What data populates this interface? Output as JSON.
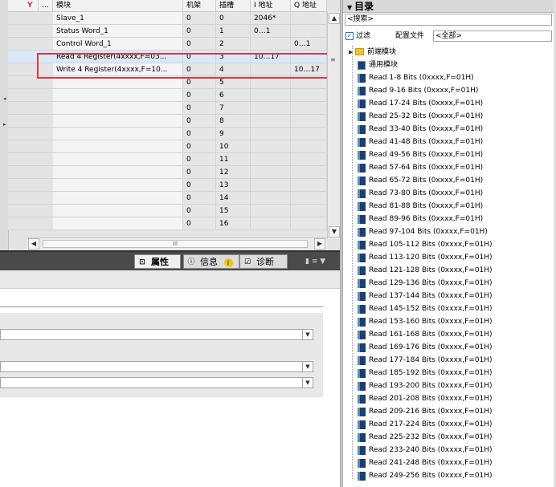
{
  "table": {
    "header": {
      "ellipsis": "...",
      "module": "模块",
      "rack": "机架",
      "slot": "插槽",
      "i_address": "I 地址",
      "q_address": "Q 地址"
    },
    "rows": [
      {
        "module": "Slave_1",
        "rack": "0",
        "slot": "0",
        "i_address": "2046*",
        "q_address": ""
      },
      {
        "module": "Status Word_1",
        "rack": "0",
        "slot": "1",
        "i_address": "0…1",
        "q_address": ""
      },
      {
        "module": "Control Word_1",
        "rack": "0",
        "slot": "2",
        "i_address": "",
        "q_address": "0…1"
      },
      {
        "module": "Read 4 Register(4xxxx,F=03...",
        "rack": "0",
        "slot": "3",
        "i_address": "10…17",
        "q_address": ""
      },
      {
        "module": "Write 4 Register(4xxxx,F=10...",
        "rack": "0",
        "slot": "4",
        "i_address": "",
        "q_address": "10…17"
      },
      {
        "module": "",
        "rack": "0",
        "slot": "5",
        "i_address": "",
        "q_address": ""
      },
      {
        "module": "",
        "rack": "0",
        "slot": "6",
        "i_address": "",
        "q_address": ""
      },
      {
        "module": "",
        "rack": "0",
        "slot": "7",
        "i_address": "",
        "q_address": ""
      },
      {
        "module": "",
        "rack": "0",
        "slot": "8",
        "i_address": "",
        "q_address": ""
      },
      {
        "module": "",
        "rack": "0",
        "slot": "9",
        "i_address": "",
        "q_address": ""
      },
      {
        "module": "",
        "rack": "0",
        "slot": "10",
        "i_address": "",
        "q_address": ""
      },
      {
        "module": "",
        "rack": "0",
        "slot": "11",
        "i_address": "",
        "q_address": ""
      },
      {
        "module": "",
        "rack": "0",
        "slot": "12",
        "i_address": "",
        "q_address": ""
      },
      {
        "module": "",
        "rack": "0",
        "slot": "13",
        "i_address": "",
        "q_address": ""
      },
      {
        "module": "",
        "rack": "0",
        "slot": "14",
        "i_address": "",
        "q_address": ""
      },
      {
        "module": "",
        "rack": "0",
        "slot": "15",
        "i_address": "",
        "q_address": ""
      },
      {
        "module": "",
        "rack": "0",
        "slot": "16",
        "i_address": "",
        "q_address": ""
      }
    ],
    "selected_row": 3,
    "hscroll_thumb": "III"
  },
  "inspector": {
    "tabs": [
      {
        "label": "属性",
        "icon": "properties-icon"
      },
      {
        "label": "信息",
        "icon": "info-icon",
        "badge": "i"
      },
      {
        "label": "诊断",
        "icon": "diagnostics-icon"
      }
    ]
  },
  "catalog": {
    "title": "目录",
    "search_placeholder": "<搜索>",
    "filter_label": "过滤",
    "filter_checked": true,
    "profile_label": "配置文件",
    "profile_value": "<全部>",
    "folders": [
      {
        "label": "前端模块",
        "expanded": false
      },
      {
        "label": "通用模块"
      }
    ],
    "modules": [
      "Read 1-8 Bits (0xxxx,F=01H)",
      "Read 9-16 Bits (0xxxx,F=01H)",
      "Read 17-24 Bits (0xxxx,F=01H)",
      "Read 25-32 Bits (0xxxx,F=01H)",
      "Read 33-40 Bits (0xxxx,F=01H)",
      "Read 41-48 Bits (0xxxx,F=01H)",
      "Read 49-56 Bits (0xxxx,F=01H)",
      "Read 57-64 Bits (0xxxx,F=01H)",
      "Read 65-72 Bits (0xxxx,F=01H)",
      "Read 73-80 Bits (0xxxx,F=01H)",
      "Read 81-88 Bits (0xxxx,F=01H)",
      "Read 89-96 Bits (0xxxx,F=01H)",
      "Read 97-104 Bits (0xxxx,F=01H)",
      "Read 105-112 Bits (0xxxx,F=01H)",
      "Read 113-120 Bits (0xxxx,F=01H)",
      "Read 121-128 Bits (0xxxx,F=01H)",
      "Read 129-136 Bits (0xxxx,F=01H)",
      "Read 137-144 Bits (0xxxx,F=01H)",
      "Read 145-152 Bits (0xxxx,F=01H)",
      "Read 153-160 Bits (0xxxx,F=01H)",
      "Read 161-168 Bits (0xxxx,F=01H)",
      "Read 169-176 Bits (0xxxx,F=01H)",
      "Read 177-184 Bits (0xxxx,F=01H)",
      "Read 185-192 Bits (0xxxx,F=01H)",
      "Read 193-200 Bits (0xxxx,F=01H)",
      "Read 201-208 Bits (0xxxx,F=01H)",
      "Read 209-216 Bits (0xxxx,F=01H)",
      "Read 217-224 Bits (0xxxx,F=01H)",
      "Read 225-232 Bits (0xxxx,F=01H)",
      "Read 233-240 Bits (0xxxx,F=01H)",
      "Read 241-248 Bits (0xxxx,F=01H)",
      "Read 249-256 Bits (0xxxx,F=01H)"
    ]
  },
  "colors": {
    "highlight_border": "#e0373b",
    "selection": "#dbe8f7",
    "module_icon": "#1d3f6b",
    "folder_icon": "#f1c232"
  }
}
